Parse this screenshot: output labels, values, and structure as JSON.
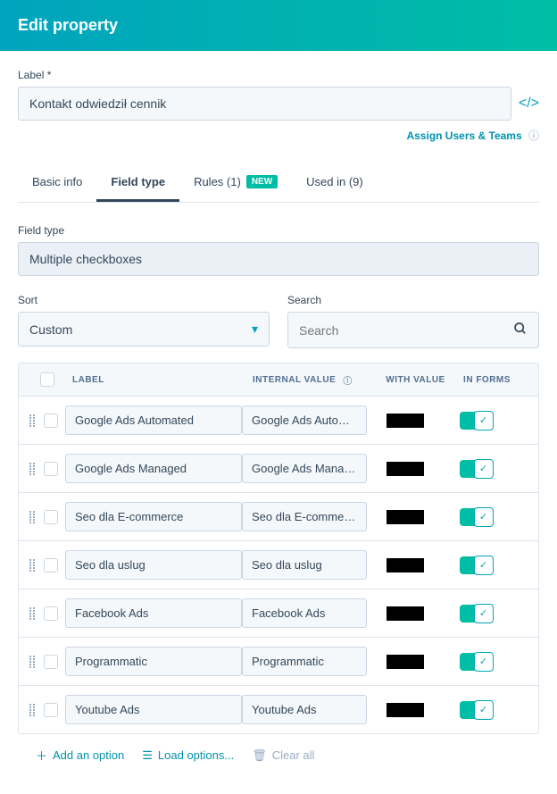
{
  "header": {
    "title": "Edit property"
  },
  "labelField": {
    "label": "Label *",
    "value": "Kontakt odwiedził cennik"
  },
  "assignLink": "Assign Users & Teams",
  "tabs": [
    {
      "label": "Basic info"
    },
    {
      "label": "Field type",
      "active": true
    },
    {
      "label": "Rules (1)",
      "badge": "NEW"
    },
    {
      "label": "Used in (9)"
    }
  ],
  "fieldType": {
    "label": "Field type",
    "value": "Multiple checkboxes"
  },
  "sort": {
    "label": "Sort",
    "value": "Custom"
  },
  "search": {
    "label": "Search",
    "placeholder": "Search"
  },
  "columns": {
    "label": "LABEL",
    "internal": "INTERNAL VALUE",
    "withValue": "WITH VALUE",
    "inForms": "IN FORMS"
  },
  "options": [
    {
      "label": "Google Ads Automated",
      "internal": "Google Ads Automated",
      "inForms": true
    },
    {
      "label": "Google Ads Managed",
      "internal": "Google Ads Managed",
      "inForms": true
    },
    {
      "label": "Seo dla E-commerce",
      "internal": "Seo dla E-commerce",
      "inForms": true
    },
    {
      "label": "Seo dla uslug",
      "internal": "Seo dla uslug",
      "inForms": true
    },
    {
      "label": "Facebook Ads",
      "internal": "Facebook Ads",
      "inForms": true
    },
    {
      "label": "Programmatic",
      "internal": "Programmatic",
      "inForms": true
    },
    {
      "label": "Youtube Ads",
      "internal": "Youtube Ads",
      "inForms": true
    }
  ],
  "footer": {
    "add": "Add an option",
    "load": "Load options...",
    "clear": "Clear all"
  }
}
